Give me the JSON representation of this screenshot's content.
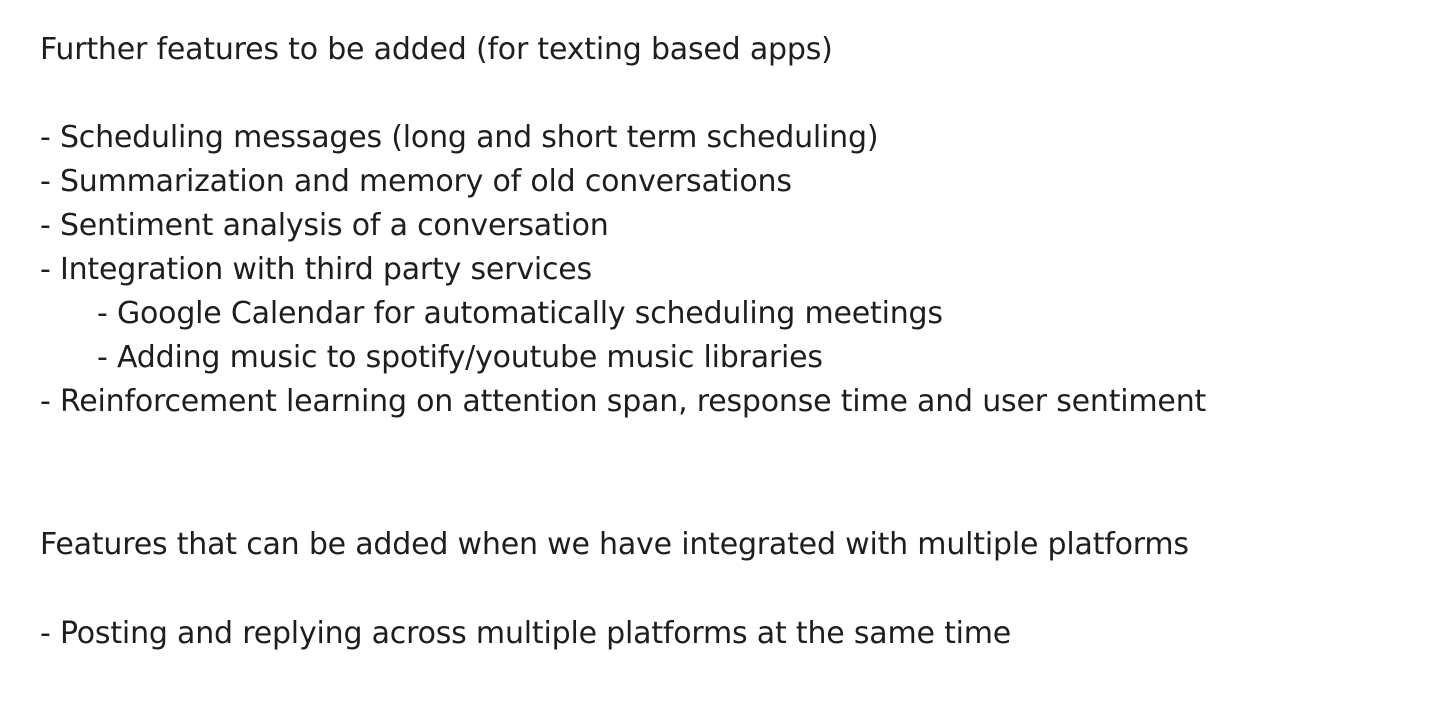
{
  "section1": {
    "heading": "Further features to be added (for texting based apps)",
    "items": [
      "- Scheduling messages (long and short term scheduling)",
      "- Summarization and memory of old conversations",
      "- Sentiment analysis of a conversation",
      "- Integration with third party services",
      "- Google Calendar for automatically scheduling meetings",
      "- Adding music to spotify/youtube music libraries",
      "- Reinforcement learning on attention span, response time and user sentiment"
    ]
  },
  "section2": {
    "heading": "Features that can be added when we have integrated with multiple platforms",
    "items": [
      "- Posting and replying across multiple platforms at the same time"
    ]
  }
}
